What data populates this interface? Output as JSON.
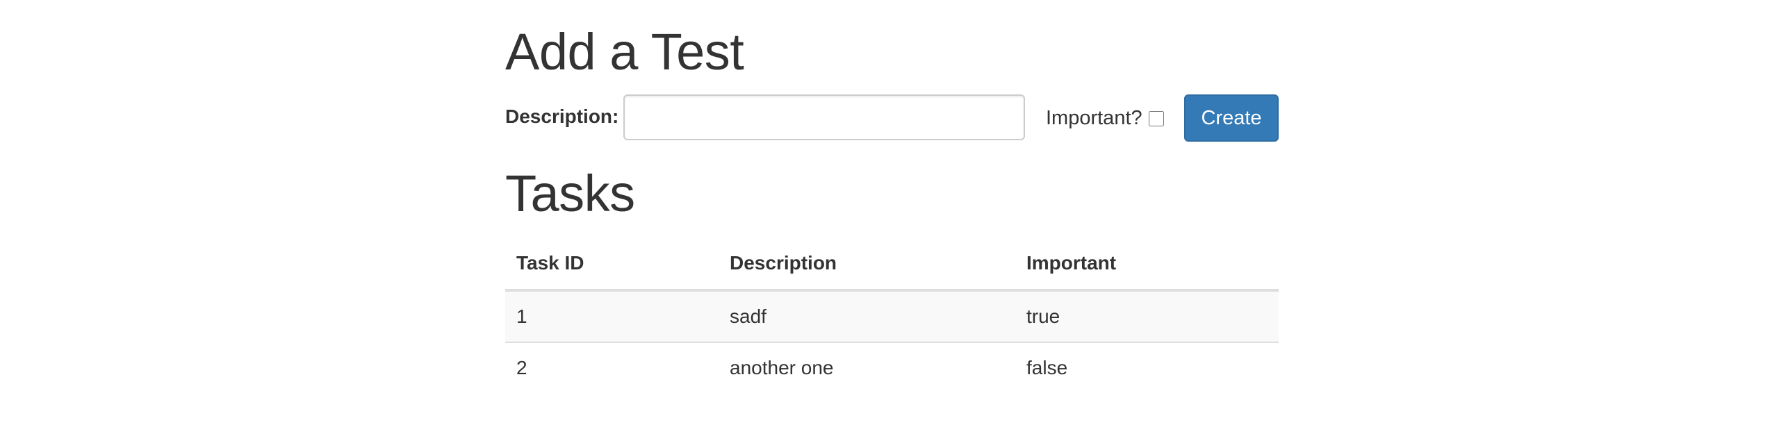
{
  "add_section": {
    "title": "Add a Test",
    "description_label": "Description:",
    "description_value": "",
    "description_placeholder": "",
    "important_label": "Important?",
    "important_checked": false,
    "create_label": "Create"
  },
  "tasks_section": {
    "title": "Tasks",
    "columns": [
      "Task ID",
      "Description",
      "Important"
    ],
    "rows": [
      {
        "id": "1",
        "description": "sadf",
        "important": "true"
      },
      {
        "id": "2",
        "description": "another one",
        "important": "false"
      }
    ]
  },
  "colors": {
    "primary_button": "#337ab7",
    "text": "#333333",
    "stripe": "#f9f9f9",
    "border": "#dddddd"
  }
}
